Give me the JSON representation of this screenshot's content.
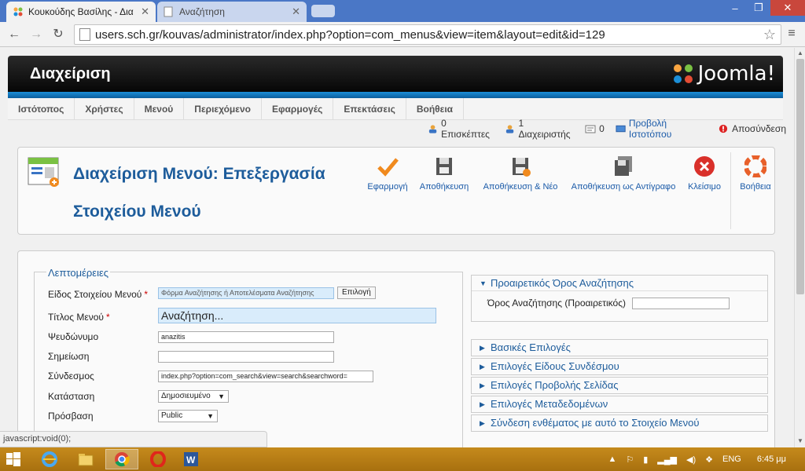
{
  "browser": {
    "tabs": [
      {
        "title": "Κουκούδης Βασίλης - Δια",
        "active": true
      },
      {
        "title": "Αναζήτηση",
        "active": false
      }
    ],
    "url": "users.sch.gr/kouvas/administrator/index.php?option=com_menus&view=item&layout=edit&id=129",
    "window_controls": {
      "minimize": "–",
      "maximize": "❐",
      "close": "✕"
    }
  },
  "header": {
    "title": "Διαχείριση",
    "logo_text": "Joomla!"
  },
  "menu": [
    "Ιστότοπος",
    "Χρήστες",
    "Μενού",
    "Περιεχόμενο",
    "Εφαρμογές",
    "Επεκτάσεις",
    "Βοήθεια"
  ],
  "status": {
    "visitors": "0 Επισκέπτες",
    "admins": "1 Διαχειριστής",
    "messages": "0",
    "view_site": "Προβολή Ιστοτόπου",
    "logout": "Αποσύνδεση"
  },
  "page": {
    "title": "Διαχείριση Μενού: Επεξεργασία Στοιχείου Μενού"
  },
  "toolbar": {
    "apply": "Εφαρμογή",
    "save": "Αποθήκευση",
    "save_new": "Αποθήκευση & Νέο",
    "save_copy": "Αποθήκευση ως Αντίγραφο",
    "close": "Κλείσιμο",
    "help": "Βοήθεια"
  },
  "details": {
    "legend": "Λεπτομέρειες",
    "type_label": "Είδος Στοιχείου Μενού",
    "type_value": "Φόρμα Αναζήτησης ή Αποτελέσματα Αναζήτησης",
    "select_button": "Επιλογή",
    "title_label": "Τίτλος Μενού",
    "title_value": "Αναζήτηση...",
    "alias_label": "Ψευδώνυμο",
    "alias_value": "anazitis",
    "note_label": "Σημείωση",
    "note_value": "",
    "link_label": "Σύνδεσμος",
    "link_value": "index.php?option=com_search&view=search&searchword=",
    "status_label": "Κατάσταση",
    "status_value": "Δημοσιευμένο",
    "access_label": "Πρόσβαση",
    "access_value": "Public"
  },
  "panels": {
    "optional_search": "Προαιρετικός Όρος Αναζήτησης",
    "search_term_label": "Όρος Αναζήτησης (Προαιρετικός)",
    "basic": "Βασικές Επιλογές",
    "link_type": "Επιλογές Είδους Συνδέσμου",
    "page_display": "Επιλογές Προβολής Σελίδας",
    "metadata": "Επιλογές Μεταδεδομένων",
    "module_assignment": "Σύνδεση ενθέματος με αυτό το Στοιχείο Μενού"
  },
  "statusbar": "javascript:void(0);",
  "taskbar": {
    "lang": "ENG",
    "time": "6:45 μμ"
  }
}
